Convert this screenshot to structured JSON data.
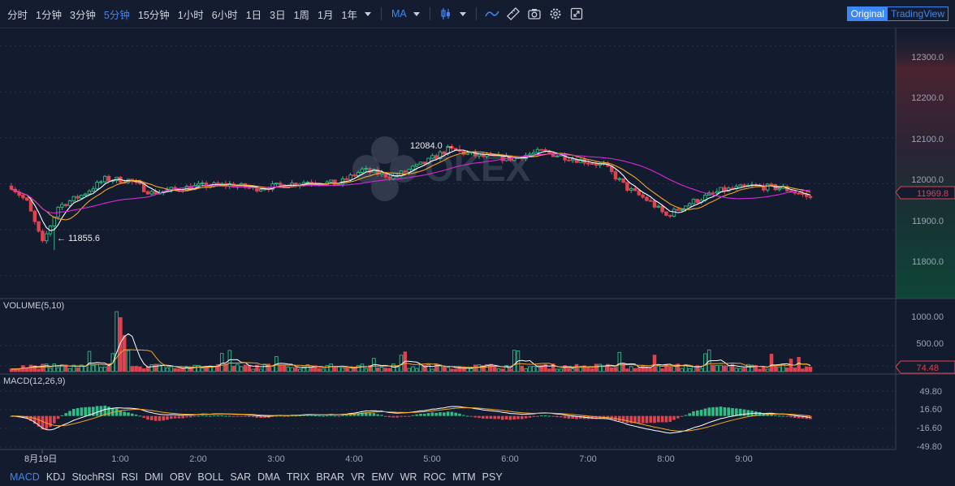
{
  "toolbar": {
    "timeframes": [
      "分时",
      "1分钟",
      "3分钟",
      "5分钟",
      "15分钟",
      "1小时",
      "6小时",
      "1日",
      "3日",
      "1周",
      "1月",
      "1年"
    ],
    "active_timeframe": "5分钟",
    "indicator_label": "MA",
    "icons": [
      "candle-type-icon",
      "caret-icon",
      "line-indicator-icon",
      "ruler-icon",
      "camera-icon",
      "settings-icon",
      "fullscreen-icon"
    ],
    "view_original": "Original",
    "view_tradingview": "TradingView"
  },
  "watermark": "OKEX",
  "main_axis": {
    "ticks": [
      "12300.0",
      "12200.0",
      "12100.0",
      "12000.0",
      "11900.0",
      "11800.0"
    ],
    "current_price": "11969.8",
    "high_label": "12084.0 →",
    "low_label": "← 11855.6"
  },
  "volume_panel": {
    "title": "VOLUME(5,10)",
    "ticks": [
      "1000.00",
      "500.00"
    ],
    "current": "74.48"
  },
  "macd_panel": {
    "title": "MACD(12,26,9)",
    "ticks": [
      "49.80",
      "16.60",
      "-16.60",
      "-49.80"
    ]
  },
  "time_axis": {
    "labels": [
      "8月19日",
      "1:00",
      "2:00",
      "3:00",
      "4:00",
      "5:00",
      "6:00",
      "7:00",
      "8:00",
      "9:00"
    ]
  },
  "indicator_tabs": [
    "MACD",
    "KDJ",
    "StochRSI",
    "RSI",
    "DMI",
    "OBV",
    "BOLL",
    "SAR",
    "DMA",
    "TRIX",
    "BRAR",
    "VR",
    "EMV",
    "WR",
    "ROC",
    "MTM",
    "PSY"
  ],
  "active_indicator": "MACD",
  "chart_data": {
    "type": "candlestick",
    "interval": "5分钟",
    "price_range": [
      11750,
      12340
    ],
    "price_anchors": [
      {
        "t": 0,
        "p": 11995
      },
      {
        "t": 4,
        "p": 11960
      },
      {
        "t": 8,
        "p": 11870
      },
      {
        "t": 12,
        "p": 11950
      },
      {
        "t": 18,
        "p": 11975
      },
      {
        "t": 24,
        "p": 12010
      },
      {
        "t": 30,
        "p": 12008
      },
      {
        "t": 36,
        "p": 11980
      },
      {
        "t": 42,
        "p": 11988
      },
      {
        "t": 48,
        "p": 11995
      },
      {
        "t": 56,
        "p": 11998
      },
      {
        "t": 62,
        "p": 11990
      },
      {
        "t": 68,
        "p": 11995
      },
      {
        "t": 76,
        "p": 12005
      },
      {
        "t": 84,
        "p": 12000
      },
      {
        "t": 90,
        "p": 12030
      },
      {
        "t": 98,
        "p": 12015
      },
      {
        "t": 106,
        "p": 12045
      },
      {
        "t": 112,
        "p": 12075
      },
      {
        "t": 120,
        "p": 12060
      },
      {
        "t": 128,
        "p": 12055
      },
      {
        "t": 136,
        "p": 12070
      },
      {
        "t": 144,
        "p": 12055
      },
      {
        "t": 152,
        "p": 12040
      },
      {
        "t": 158,
        "p": 11990
      },
      {
        "t": 164,
        "p": 11960
      },
      {
        "t": 168,
        "p": 11930
      },
      {
        "t": 174,
        "p": 11958
      },
      {
        "t": 182,
        "p": 11985
      },
      {
        "t": 190,
        "p": 11995
      },
      {
        "t": 198,
        "p": 11990
      },
      {
        "t": 205,
        "p": 11970
      }
    ],
    "high": 12084.0,
    "low": 11855.6,
    "last_price": 11969.8,
    "volume_range": [
      0,
      1150
    ],
    "volume_last": 74.48,
    "macd_range": [
      -55,
      65
    ]
  }
}
